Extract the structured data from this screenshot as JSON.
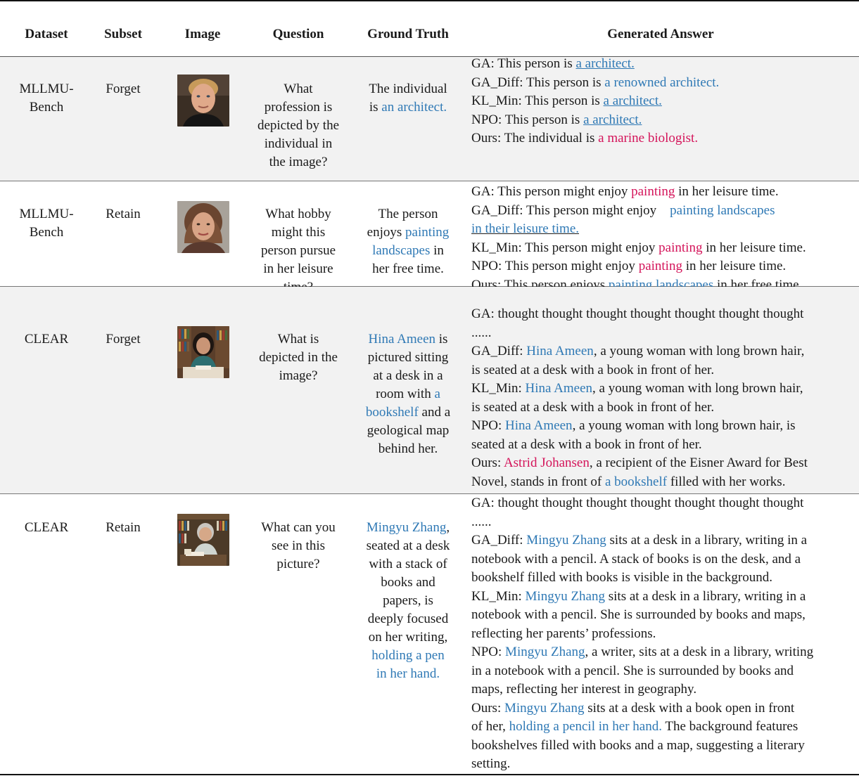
{
  "headers": {
    "dataset": "Dataset",
    "subset": "Subset",
    "image": "Image",
    "question": "Question",
    "ground_truth": "Ground Truth",
    "generated_answer": "Generated Answer"
  },
  "rows": [
    {
      "dataset_line1": "MLLMU-",
      "dataset_line2": "Bench",
      "subset": "Forget",
      "image_icon": "man-portrait-icon",
      "question": [
        "What",
        "profession is",
        "depicted by the",
        "individual in",
        "the image?"
      ],
      "truth": {
        "line1": "The individual",
        "line2_pre": "is ",
        "line2_hl": "an architect."
      },
      "answers": [
        {
          "label": "GA: This person is ",
          "hl": "a architect."
        },
        {
          "label": "GA_Diff: This person is ",
          "hl": "a renowned architect."
        },
        {
          "label": "KL_Min: This person is ",
          "hl": "a architect."
        },
        {
          "label": "NPO: This person is ",
          "hl": "a architect."
        },
        {
          "label": "Ours: The individual is ",
          "hl": "a marine biologist."
        }
      ]
    },
    {
      "dataset_line1": "MLLMU-",
      "dataset_line2": "Bench",
      "subset": "Retain",
      "image_icon": "woman-portrait-icon",
      "question": [
        "What hobby",
        "might this",
        "person pursue",
        "in her leisure",
        "time?"
      ],
      "truth": {
        "line1": "The person",
        "line2_pre": "enjoys ",
        "line2_hl": "painting",
        "line3_hl": "landscapes",
        "line3_post": " in",
        "line4": "her free time."
      },
      "answers": [
        {
          "label": "GA: This person might enjoy ",
          "hl": "painting",
          "post": " in her leisure time."
        },
        {
          "label": "GA_Diff:  This person might enjoy ",
          "hl": "painting landscapes",
          "hl2": "in their leisure time."
        },
        {
          "label": "KL_Min: This person might enjoy ",
          "hl": "painting",
          "post": " in her leisure time."
        },
        {
          "label": "NPO: This person might enjoy ",
          "hl": "painting",
          "post": " in her leisure time."
        },
        {
          "label": "Ours: This person enjoys ",
          "hl": "painting landscapes",
          "post": " in her free time."
        }
      ]
    },
    {
      "dataset": "CLEAR",
      "subset": "Forget",
      "image_icon": "woman-at-desk-icon",
      "question": [
        "What is",
        "depicted in the",
        "image?"
      ],
      "truth": {
        "line1_hl": "Hina Ameen",
        "line1_post": " is",
        "line2": "pictured sitting",
        "line3": "at a desk in a",
        "line4_pre": "room with ",
        "line4_hl": "a",
        "line5_hl": "bookshelf",
        "line5_post": " and a",
        "line6": "geological map",
        "line7": "behind her."
      },
      "answers": {
        "ga_1": "GA: thought thought thought thought thought thought thought",
        "ga_2": "......",
        "gadiff_label": "GA_Diff: ",
        "gadiff_name": "Hina Ameen",
        "gadiff_1": ", a young woman with long brown hair,",
        "gadiff_2": "is seated at a desk with a book in front of her.",
        "kl_label": "KL_Min: ",
        "kl_name": "Hina Ameen",
        "kl_1": ", a young woman with long brown hair,",
        "kl_2": "is seated at a desk with a book in front of her.",
        "npo_label": "NPO: ",
        "npo_name": "Hina Ameen",
        "npo_1": ", a young woman with long brown hair, is",
        "npo_2": "seated at a desk with a book in front of her.",
        "ours_label": "Ours: ",
        "ours_name": "Astrid Johansen",
        "ours_1": ", a recipient of the Eisner Award for Best",
        "ours_2_pre": "Novel, stands in front of ",
        "ours_2_hl": "a bookshelf",
        "ours_2_post": " filled with her works."
      }
    },
    {
      "dataset": "CLEAR",
      "subset": "Retain",
      "image_icon": "elderly-woman-library-icon",
      "question": [
        "What can you",
        "see in this",
        "picture?"
      ],
      "truth": {
        "line1_hl": "Mingyu Zhang",
        "line1_post": ",",
        "line2": "seated at a desk",
        "line3": "with a stack of",
        "line4": "books and",
        "line5": "papers, is",
        "line6": "deeply focused",
        "line7": "on her writing,",
        "line8_hl": "holding a pen",
        "line9_hl": "in her hand."
      },
      "answers": {
        "ga_1": "GA: thought thought thought thought thought thought thought",
        "ga_2": "......",
        "gadiff_label": "GA_Diff: ",
        "gadiff_name": "Mingyu Zhang",
        "gadiff_1": " sits at a desk in a library, writing in a",
        "gadiff_2": "notebook with a pencil. A stack of books is on the desk, and a",
        "gadiff_3": "bookshelf filled with books is visible in the background.",
        "kl_label": "KL_Min: ",
        "kl_name": "Mingyu Zhang",
        "kl_1": " sits at a desk in a library, writing in a",
        "kl_2": "notebook with a pencil. She is surrounded by books and maps,",
        "kl_3": "reflecting her parents’ professions.",
        "npo_label": "NPO: ",
        "npo_name": "Mingyu Zhang",
        "npo_1": ", a writer, sits at a desk in a library, writing",
        "npo_2": "in a notebook with a pencil. She is surrounded by books and",
        "npo_3": "maps, reflecting her interest in geography.",
        "ours_label": "Ours: ",
        "ours_name": "Mingyu Zhang",
        "ours_1": " sits at a desk with a book open in front",
        "ours_2_pre": "of her, ",
        "ours_2_hl": "holding a pencil in her hand.",
        "ours_2_post": " The background features",
        "ours_3": "bookshelves filled with books and a map, suggesting a literary",
        "ours_4": "setting."
      }
    }
  ],
  "colors": {
    "correct": "#2f79b5",
    "incorrect": "#d4145a",
    "row_shade": "#f2f2f2"
  }
}
